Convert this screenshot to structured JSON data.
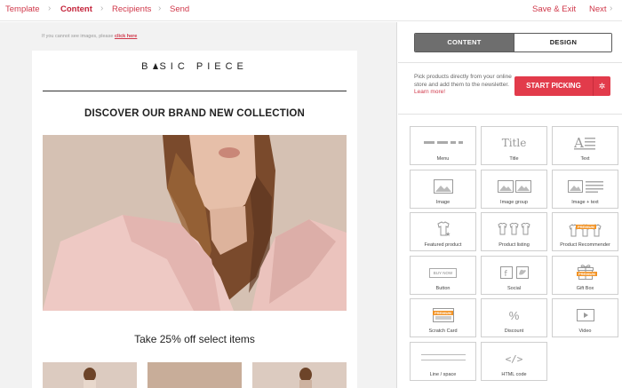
{
  "nav": {
    "steps": [
      "Template",
      "Content",
      "Recipients",
      "Send"
    ],
    "active_step": "Content",
    "save_exit": "Save & Exit",
    "next": "Next"
  },
  "email": {
    "no_images_text": "If you cannot see images, please",
    "click_here": "click here",
    "logo": {
      "left": "B",
      "right": "SIC PIECE"
    },
    "headline": "DISCOVER OUR BRAND NEW COLLECTION",
    "offer": "Take 25% off select items"
  },
  "panel": {
    "tabs": {
      "content": "CONTENT",
      "design": "DESIGN"
    },
    "pick_text": "Pick products directly from your online store and add them to the newsletter.",
    "learn_more": "Learn more!",
    "start_picking": "START PICKING",
    "blocks": [
      {
        "label": "Menu",
        "icon": "menu-icon"
      },
      {
        "label": "Title",
        "icon": "title-icon"
      },
      {
        "label": "Text",
        "icon": "text-icon"
      },
      {
        "label": "Image",
        "icon": "image-icon"
      },
      {
        "label": "Image group",
        "icon": "image-group-icon"
      },
      {
        "label": "Image + text",
        "icon": "image-text-icon"
      },
      {
        "label": "Featured product",
        "icon": "featured-product-icon"
      },
      {
        "label": "Product listing",
        "icon": "product-listing-icon"
      },
      {
        "label": "Product Recommender",
        "icon": "product-recommender-icon"
      },
      {
        "label": "Button",
        "icon": "button-icon"
      },
      {
        "label": "Social",
        "icon": "social-icon"
      },
      {
        "label": "Gift Box",
        "icon": "gift-box-icon"
      },
      {
        "label": "Scratch Card",
        "icon": "scratch-card-icon"
      },
      {
        "label": "Discount",
        "icon": "discount-icon"
      },
      {
        "label": "Video",
        "icon": "video-icon"
      },
      {
        "label": "Line / space",
        "icon": "line-space-icon"
      },
      {
        "label": "HTML code",
        "icon": "html-code-icon"
      }
    ],
    "icon_text": {
      "title": "Title",
      "button": "BUY NOW",
      "premium": "PREMIUM",
      "discount": "%"
    }
  },
  "colors": {
    "accent": "#e23b4b",
    "accent_text": "#d0384a",
    "premium_badge": "#f29325",
    "toggle_active": "#6e6e6e"
  }
}
